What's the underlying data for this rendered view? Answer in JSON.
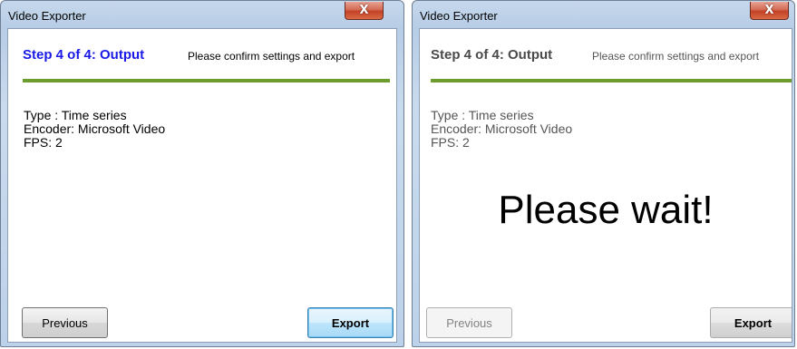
{
  "colors": {
    "divider": "#6b9c2d",
    "step_title_active": "#1a1ae6",
    "step_title_inactive": "#4a4a4a",
    "subtitle_inactive": "#555555",
    "info_inactive": "#555555"
  },
  "left_window": {
    "title": "Video Exporter",
    "close_label": "X",
    "step_title": "Step 4 of 4: Output",
    "step_subtitle": "Please confirm settings and export",
    "info": {
      "type": "Type : Time series",
      "encoder": "Encoder: Microsoft Video",
      "fps": "FPS: 2"
    },
    "previous_label": "Previous",
    "export_label": "Export"
  },
  "right_window": {
    "title": "Video Exporter",
    "close_label": "X",
    "step_title": "Step 4 of 4: Output",
    "step_subtitle": "Please confirm settings and export",
    "info": {
      "type": "Type : Time series",
      "encoder": "Encoder: Microsoft Video",
      "fps": "FPS: 2"
    },
    "wait_message": "Please wait!",
    "previous_label": "Previous",
    "export_label": "Export"
  }
}
